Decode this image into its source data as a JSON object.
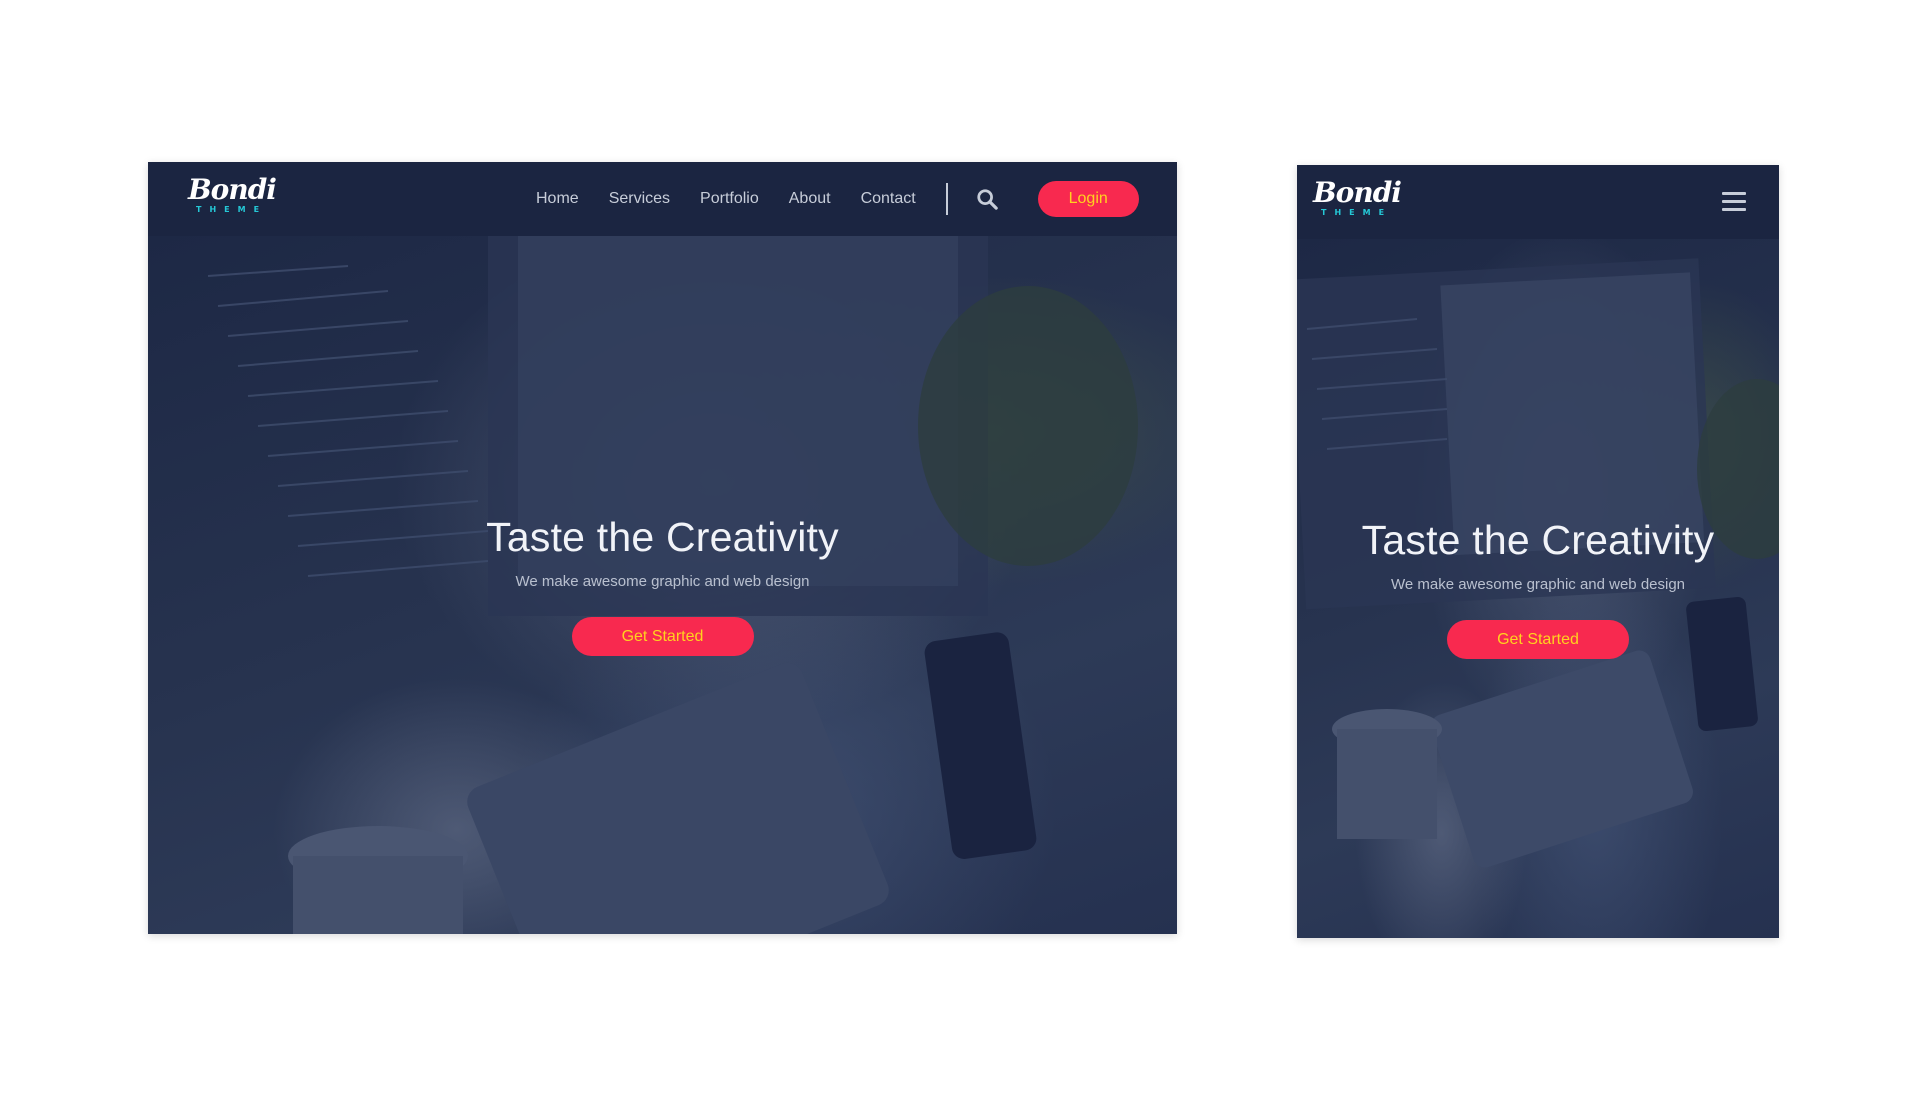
{
  "brand": {
    "logo_text": "Bondi",
    "logo_subtext": "THEME"
  },
  "desktop": {
    "nav": {
      "items": [
        {
          "label": "Home"
        },
        {
          "label": "Services"
        },
        {
          "label": "Portfolio"
        },
        {
          "label": "About"
        },
        {
          "label": "Contact"
        }
      ],
      "search_icon": "search-icon",
      "login_label": "Login"
    },
    "hero": {
      "title": "Taste the Creativity",
      "subtitle": "We make awesome graphic and web design",
      "cta_label": "Get Started"
    }
  },
  "mobile": {
    "nav": {
      "menu_icon": "hamburger-menu-icon"
    },
    "hero": {
      "title": "Taste the Creativity",
      "subtitle": "We make awesome graphic and web design",
      "cta_label": "Get Started"
    }
  },
  "colors": {
    "accent": "#f8294f",
    "accent_text": "#ffd21f",
    "navbar": "#1b2541",
    "logo_sub": "#25c8d6"
  }
}
